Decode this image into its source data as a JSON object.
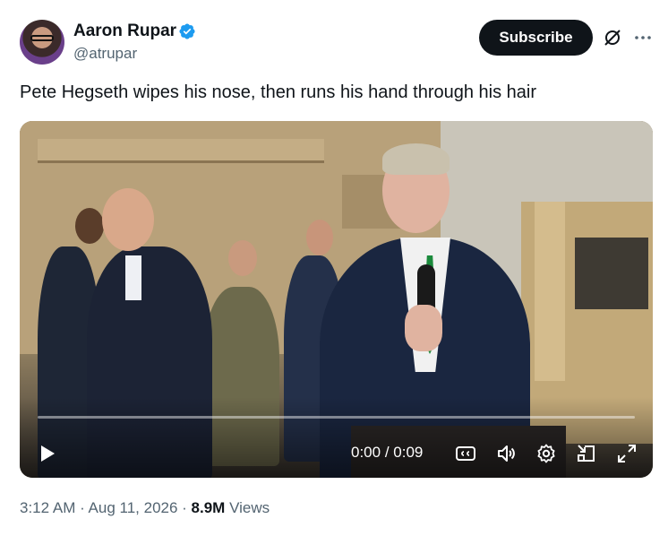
{
  "author": {
    "name": "Aaron Rupar",
    "handle": "@atrupar",
    "verified": true
  },
  "subscribe_label": "Subscribe",
  "tweet_text": "Pete Hegseth wipes his nose, then runs his hand through his hair",
  "video": {
    "current_time": "0:00",
    "separator": " / ",
    "duration": "0:09",
    "progress_fraction": 0.0,
    "controls": [
      "play-icon",
      "closed-captions-icon",
      "volume-icon",
      "settings-icon",
      "picture-in-picture-icon",
      "fullscreen-icon"
    ]
  },
  "meta": {
    "time": "3:12 AM",
    "dot": " · ",
    "date": "Aug 11, 2026",
    "views_count": "8.9M",
    "views_label": "Views"
  },
  "colors": {
    "text_primary": "#0f1419",
    "text_secondary": "#536471",
    "verified_blue": "#1d9bf0",
    "subscribe_bg": "#0f1419"
  }
}
